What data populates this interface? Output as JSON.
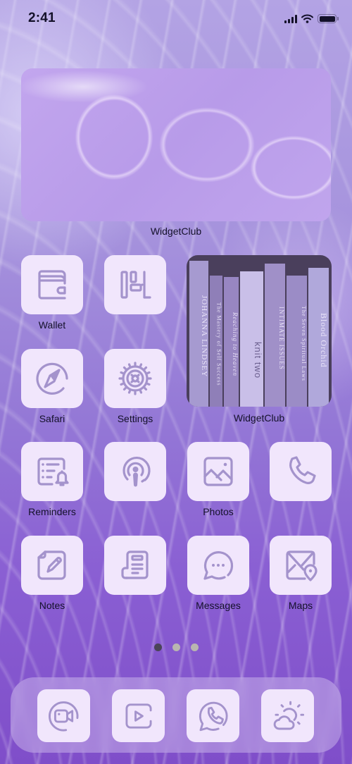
{
  "status_bar": {
    "time": "2:41",
    "icons": [
      "cellular-signal-icon",
      "wifi-icon",
      "battery-icon"
    ]
  },
  "widgets": [
    {
      "id": "widget-water",
      "label": "WidgetClub",
      "content": "purple water caustics photo"
    },
    {
      "id": "widget-books",
      "label": "WidgetClub",
      "content": "photo of book spines",
      "book_spines": [
        "JOHANNA LINDSEY",
        "The Mastery of Self Success",
        "Reaching to Heaven",
        "knit two",
        "INTIMATE ISSUES",
        "The Seven Spiritual Laws",
        "Blood Orchid"
      ]
    }
  ],
  "apps": [
    {
      "label": "Wallet",
      "icon": "wallet-icon"
    },
    {
      "label": "",
      "icon": "board-icon"
    },
    {
      "label": "Safari",
      "icon": "compass-icon"
    },
    {
      "label": "Settings",
      "icon": "gear-icon"
    },
    {
      "label": "Reminders",
      "icon": "reminder-list-bell-icon"
    },
    {
      "label": "",
      "icon": "podcast-icon"
    },
    {
      "label": "Photos",
      "icon": "photo-icon"
    },
    {
      "label": "",
      "icon": "phone-icon"
    },
    {
      "label": "Notes",
      "icon": "note-pencil-icon"
    },
    {
      "label": "",
      "icon": "news-icon"
    },
    {
      "label": "Messages",
      "icon": "chat-bubble-icon"
    },
    {
      "label": "Maps",
      "icon": "map-pin-icon"
    }
  ],
  "page_dots": {
    "count": 3,
    "active_index": 0,
    "active_color": "#4a4458",
    "inactive_color": "#b9b6b0"
  },
  "dock": [
    {
      "label": "",
      "icon": "facetime-video-icon"
    },
    {
      "label": "",
      "icon": "youtube-play-icon"
    },
    {
      "label": "",
      "icon": "whatsapp-icon"
    },
    {
      "label": "",
      "icon": "weather-sun-cloud-icon"
    }
  ],
  "colors": {
    "icon_tile": "#f1e6fc",
    "icon_glyph": "#a493cc",
    "label_text": "#14112a"
  }
}
